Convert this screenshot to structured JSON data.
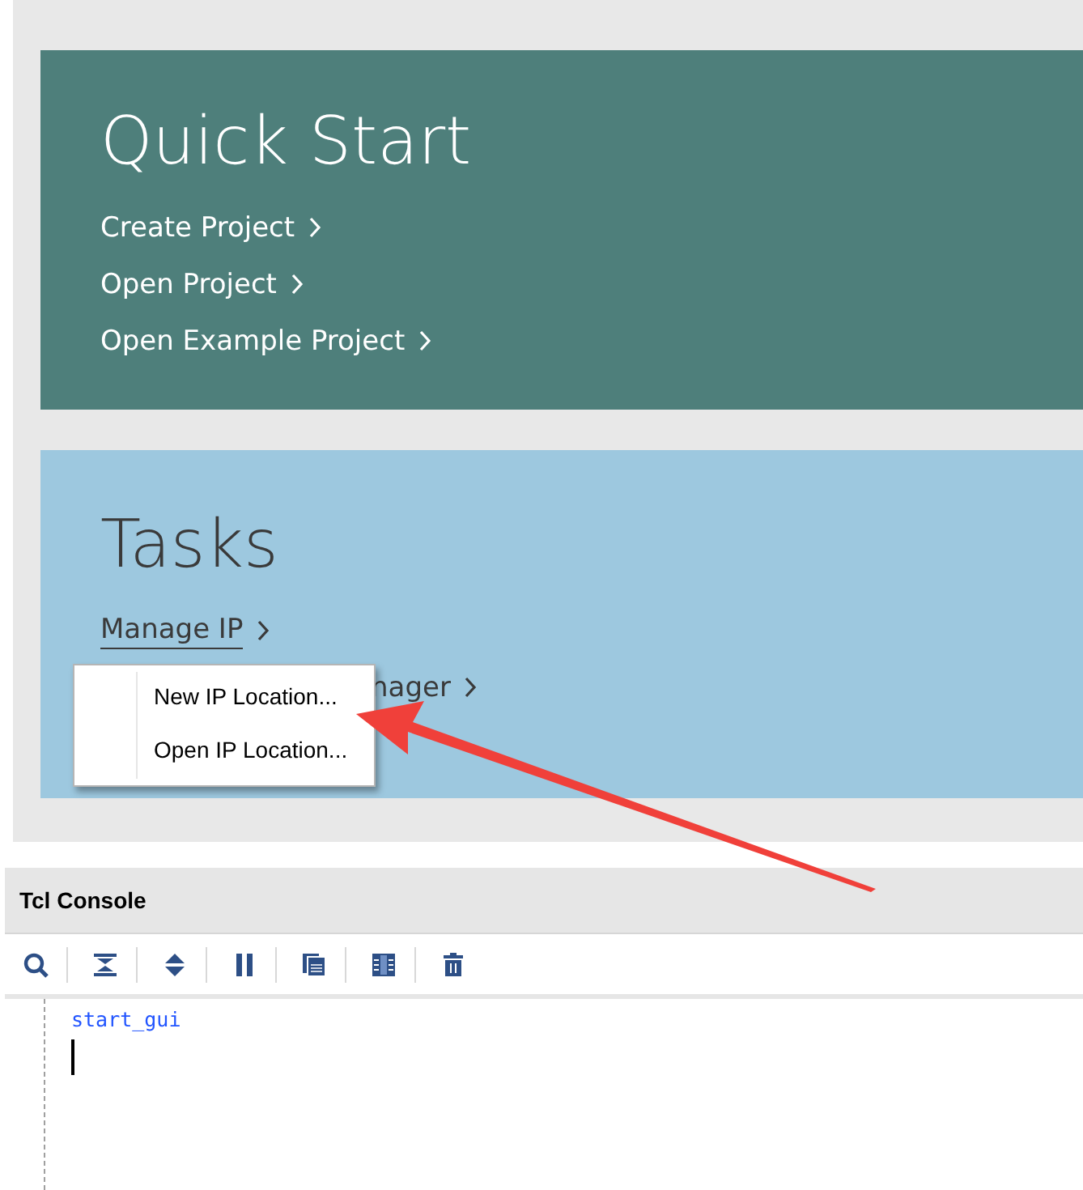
{
  "quick_start": {
    "title": "Quick Start",
    "links": [
      {
        "label": "Create Project"
      },
      {
        "label": "Open Project"
      },
      {
        "label": "Open Example Project"
      }
    ]
  },
  "tasks": {
    "title": "Tasks",
    "links": [
      {
        "label": "Manage IP",
        "selected": true,
        "kind": "full"
      },
      {
        "label": "nager",
        "selected": false,
        "kind": "covered"
      }
    ]
  },
  "context_menu": {
    "items": [
      {
        "label": "New IP Location..."
      },
      {
        "label": "Open IP Location..."
      }
    ]
  },
  "tcl_console": {
    "title": "Tcl Console",
    "toolbar": [
      {
        "kind": "search"
      },
      {
        "kind": "collapse"
      },
      {
        "kind": "expand"
      },
      {
        "kind": "pause"
      },
      {
        "kind": "copy"
      },
      {
        "kind": "columns"
      },
      {
        "kind": "delete"
      }
    ],
    "lines": [
      "start_gui"
    ]
  }
}
